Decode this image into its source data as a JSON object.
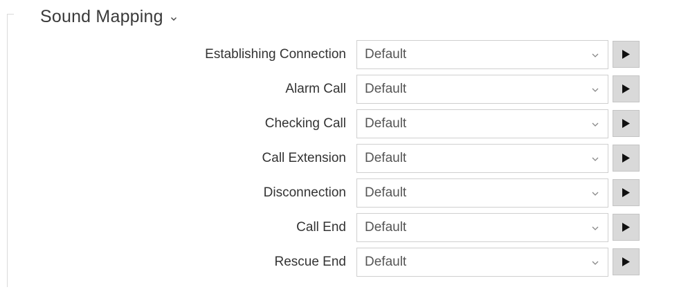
{
  "section": {
    "title": "Sound Mapping",
    "collapse_icon": "chevron-down-icon"
  },
  "rows": [
    {
      "label": "Establishing Connection",
      "value": "Default"
    },
    {
      "label": "Alarm Call",
      "value": "Default"
    },
    {
      "label": "Checking Call",
      "value": "Default"
    },
    {
      "label": "Call Extension",
      "value": "Default"
    },
    {
      "label": "Disconnection",
      "value": "Default"
    },
    {
      "label": "Call End",
      "value": "Default"
    },
    {
      "label": "Rescue End",
      "value": "Default"
    }
  ],
  "icons": {
    "select": "chevron-down-icon",
    "play": "play-icon"
  },
  "colors": {
    "button_bg": "#d9d9d9",
    "border": "#cfcfcf",
    "text": "#333333"
  }
}
